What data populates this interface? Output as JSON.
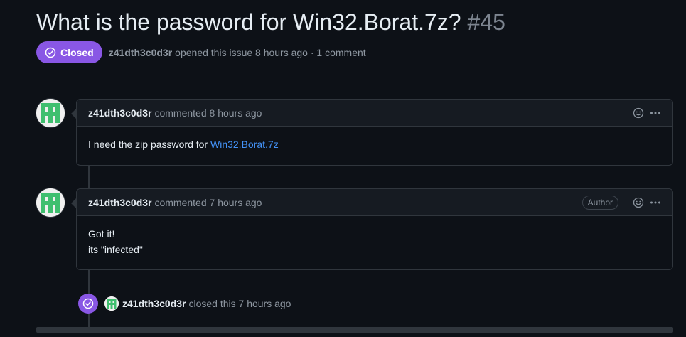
{
  "issue": {
    "title": "What is the password for Win32.Borat.7z?",
    "number": "#45",
    "state": "Closed",
    "author": "z41dth3c0d3r",
    "meta_text": "opened this issue 8 hours ago · 1 comment"
  },
  "comments": [
    {
      "author": "z41dth3c0d3r",
      "action": "commented 8 hours ago",
      "badge": "",
      "body_text": "I need the zip password for ",
      "body_link": "Win32.Borat.7z"
    },
    {
      "author": "z41dth3c0d3r",
      "action": "commented 7 hours ago",
      "badge": "Author",
      "body_line1": "Got it!",
      "body_line2": "its \"infected\""
    }
  ],
  "event": {
    "author": "z41dth3c0d3r",
    "text": "closed this 7 hours ago"
  },
  "icons": [
    "closed-check-icon",
    "smiley-icon",
    "kebab-icon",
    "identicon-avatar"
  ],
  "colors": {
    "background": "#0d1117",
    "closed_purple": "#8957e5",
    "link": "#4493f8",
    "border": "#30363d",
    "avatar_green": "#3fbf6f"
  }
}
